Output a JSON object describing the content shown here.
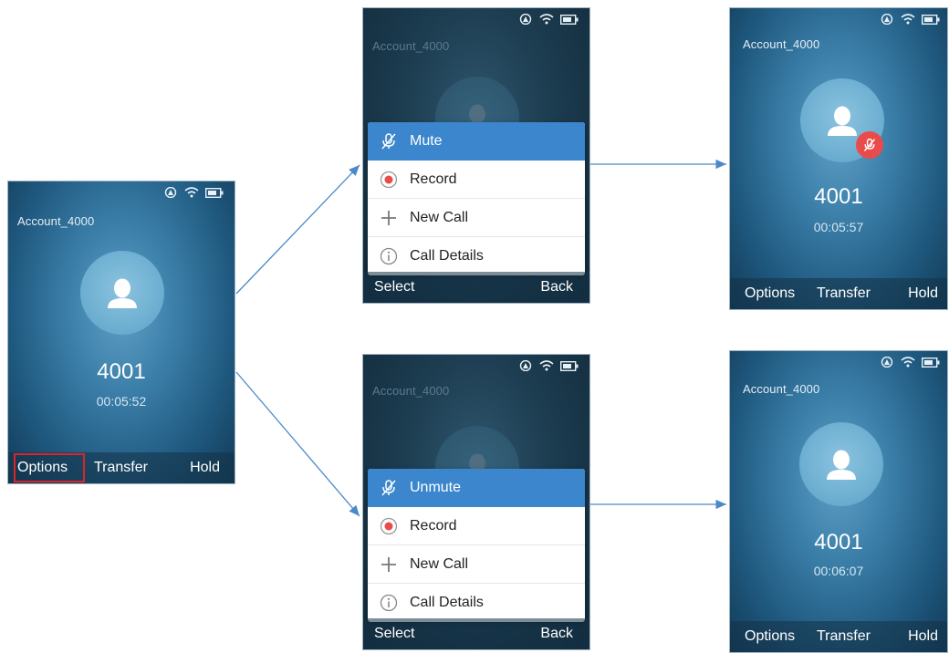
{
  "colors": {
    "menu_selected": "#3b86cc",
    "record_dot": "#e94b4b",
    "arrow": "#4a8ac8",
    "highlight": "#d9252a"
  },
  "screen1": {
    "account": "Account_4000",
    "number": "4001",
    "timer": "00:05:52",
    "softkeys": {
      "left": "Options",
      "middle": "Transfer",
      "right": "Hold"
    }
  },
  "menu_top": {
    "account": "Account_4000",
    "items": [
      {
        "label": "Mute",
        "icon": "mic-off-icon"
      },
      {
        "label": "Record",
        "icon": "record-icon"
      },
      {
        "label": "New Call",
        "icon": "plus-icon"
      },
      {
        "label": "Call Details",
        "icon": "info-icon"
      }
    ],
    "softkeys": {
      "left": "Select",
      "right": "Back"
    }
  },
  "menu_bottom": {
    "account": "Account_4000",
    "items": [
      {
        "label": "Unmute",
        "icon": "mic-off-icon"
      },
      {
        "label": "Record",
        "icon": "record-icon"
      },
      {
        "label": "New Call",
        "icon": "plus-icon"
      },
      {
        "label": "Call Details",
        "icon": "info-icon"
      }
    ],
    "softkeys": {
      "left": "Select",
      "right": "Back"
    }
  },
  "result_top": {
    "account": "Account_4000",
    "number": "4001",
    "timer": "00:05:57",
    "softkeys": {
      "left": "Options",
      "middle": "Transfer",
      "right": "Hold"
    }
  },
  "result_bottom": {
    "account": "Account_4000",
    "number": "4001",
    "timer": "00:06:07",
    "softkeys": {
      "left": "Options",
      "middle": "Transfer",
      "right": "Hold"
    }
  }
}
